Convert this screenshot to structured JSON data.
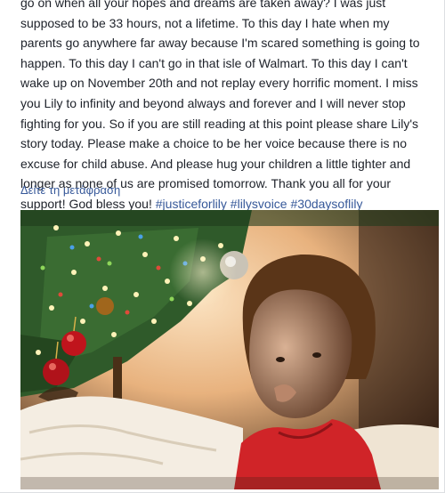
{
  "post": {
    "text_lines": [
      "go on when all your hopes and dreams are taken away? I was just",
      "supposed to be 33 hours, not a lifetime. To this day I hate when my",
      "parents go anywhere far away because I'm scared something is going to",
      "happen. To this day I can't go in that isle of Walmart. To this day I can't",
      "wake up on November 20th and not replay every horrific moment. I miss",
      "you Lily to infinity and beyond always and forever and I will never stop",
      "fighting for you. So if you are still reading at this point please share Lily's",
      "story today. Please make a choice to be her voice because there is no",
      "excuse for child abuse. And please hug your children a little tighter and",
      "longer as none of us are promised tomorrow. Thank you all for your",
      "support! God bless you!"
    ],
    "hashtags": [
      "#justiceforlily",
      "#lilysvoice",
      "#30daysoflily"
    ],
    "translate_link": "Δείτε τη μετάφραση"
  },
  "photo": {
    "subject": "child-in-front-of-christmas-tree",
    "colors": {
      "wall": "#f2c9a0",
      "shadow": "#2a1a10",
      "tree": "#2f5a2a",
      "ornament_red": "#c0141c",
      "blanket": "#f4ede2",
      "shirt": "#d02428",
      "hair": "#5a3518",
      "skin": "#caa085"
    }
  }
}
